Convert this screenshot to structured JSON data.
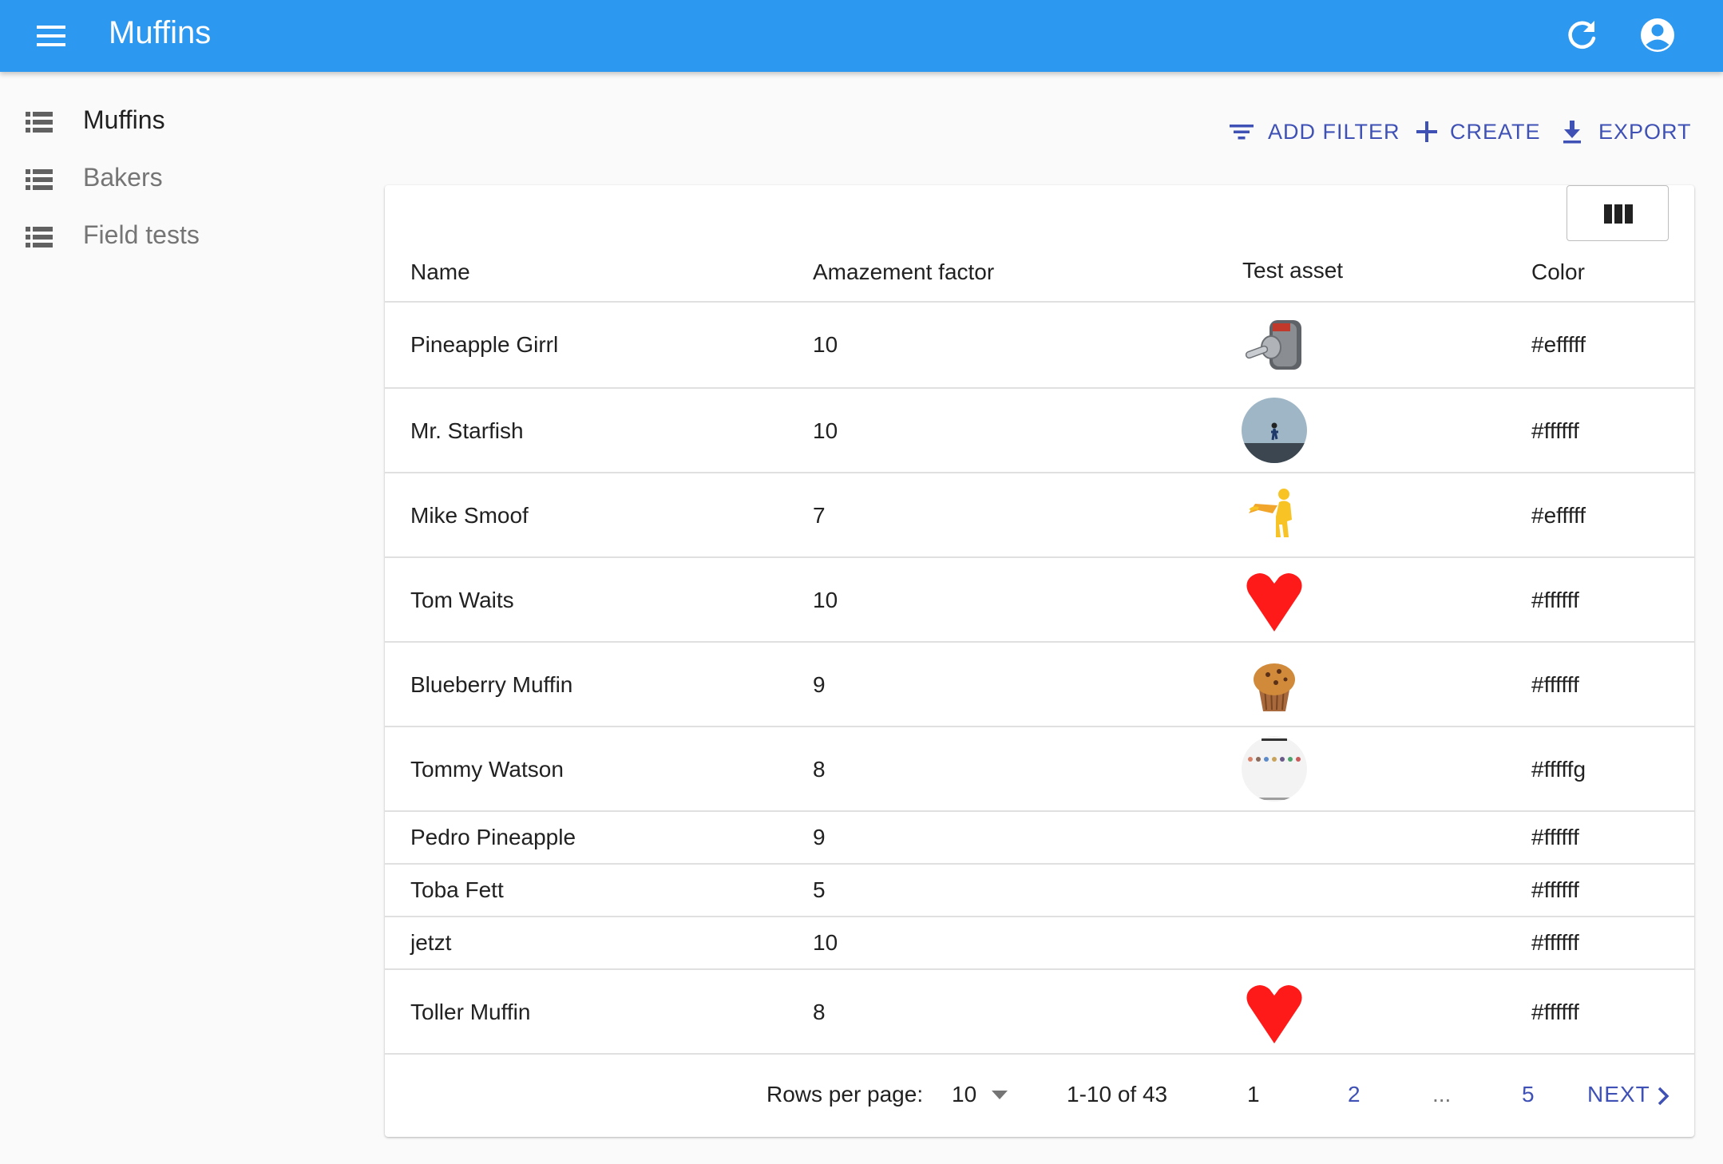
{
  "appbar": {
    "title": "Muffins",
    "background": "#2d98f0",
    "menu_icon": "menu-icon",
    "refresh_icon": "refresh-icon",
    "account_icon": "account-circle-icon"
  },
  "sidebar": {
    "items": [
      {
        "label": "Muffins",
        "icon": "list-icon",
        "active": true
      },
      {
        "label": "Bakers",
        "icon": "list-icon",
        "active": false
      },
      {
        "label": "Field tests",
        "icon": "list-icon",
        "active": false
      }
    ]
  },
  "toolbar": {
    "add_filter": "ADD FILTER",
    "create": "CREATE",
    "export": "EXPORT",
    "accent": "#3f51b5"
  },
  "table": {
    "columns_button_icon": "view-column-icon",
    "headers": [
      "Name",
      "Amazement factor",
      "Test asset",
      "Color"
    ],
    "rows": [
      {
        "name": "Pineapple Girrl",
        "amazement": "10",
        "asset": "toggle-switch-image",
        "color": "#efffff"
      },
      {
        "name": "Mr. Starfish",
        "amazement": "10",
        "asset": "person-photo-image",
        "color": "#ffffff"
      },
      {
        "name": "Mike Smoof",
        "amazement": "7",
        "asset": "superhero-figure-image",
        "color": "#efffff"
      },
      {
        "name": "Tom Waits",
        "amazement": "10",
        "asset": "heart-image",
        "color": "#ffffff"
      },
      {
        "name": "Blueberry Muffin",
        "amazement": "9",
        "asset": "muffin-image",
        "color": "#ffffff"
      },
      {
        "name": "Tommy Watson",
        "amazement": "8",
        "asset": "screenshot-image",
        "color": "#fffffg"
      },
      {
        "name": "Pedro Pineapple",
        "amazement": "9",
        "asset": "",
        "color": "#ffffff"
      },
      {
        "name": "Toba Fett",
        "amazement": "5",
        "asset": "",
        "color": "#ffffff"
      },
      {
        "name": "jetzt",
        "amazement": "10",
        "asset": "",
        "color": "#ffffff"
      },
      {
        "name": "Toller Muffin",
        "amazement": "8",
        "asset": "heart-image",
        "color": "#ffffff"
      }
    ]
  },
  "pagination": {
    "rows_per_page_label": "Rows per page:",
    "rows_per_page_value": "10",
    "range": "1-10 of 43",
    "pages": [
      "1",
      "2",
      "...",
      "5"
    ],
    "current_page": "1",
    "next": "NEXT"
  }
}
